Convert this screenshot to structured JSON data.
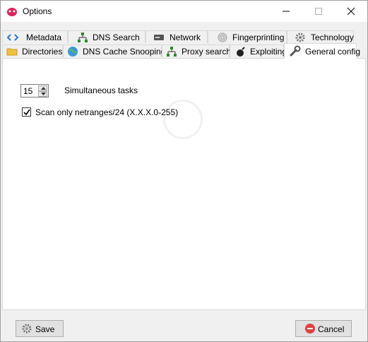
{
  "window": {
    "title": "Options"
  },
  "tabs_row1": [
    {
      "label": "Metadata",
      "icon": "code-icon"
    },
    {
      "label": "DNS Search",
      "icon": "network-tree-icon"
    },
    {
      "label": "Network",
      "icon": "server-icon"
    },
    {
      "label": "Fingerprinting",
      "icon": "fingerprint-icon"
    },
    {
      "label": "Technology",
      "icon": "gear-icon"
    }
  ],
  "tabs_row2": [
    {
      "label": "Directories",
      "icon": "folder-icon"
    },
    {
      "label": "DNS Cache Snooping",
      "icon": "globe-icon"
    },
    {
      "label": "Proxy search",
      "icon": "network-tree-icon"
    },
    {
      "label": "Exploiting",
      "icon": "bomb-icon"
    },
    {
      "label": "General config",
      "icon": "wrench-icon",
      "active": true
    }
  ],
  "general": {
    "tasks_value": "15",
    "tasks_label": "Simultaneous tasks",
    "scan_label": "Scan only netranges/24 (X.X.X.0-255)",
    "scan_checked": true
  },
  "buttons": {
    "save_label": "Save",
    "cancel_label": "Cancel"
  },
  "colors": {
    "accent": "#0078d7",
    "cancel_icon": "#e04040",
    "app_icon": "#e0205a"
  }
}
